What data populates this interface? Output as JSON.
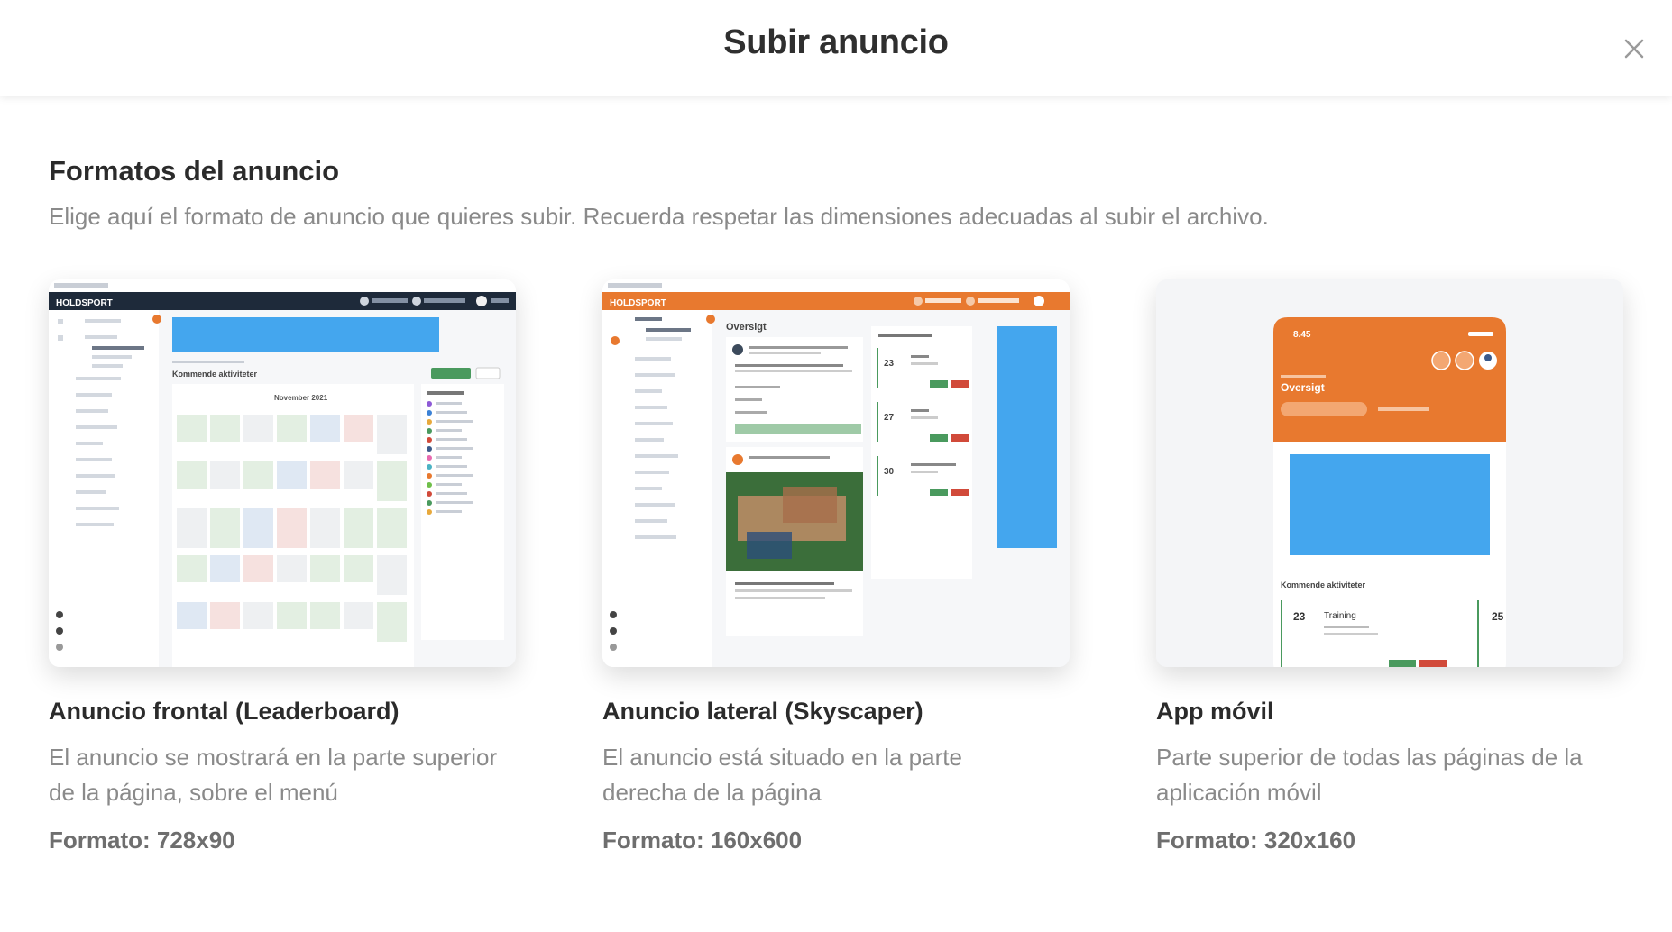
{
  "modal": {
    "title": "Subir anuncio"
  },
  "section": {
    "title": "Formatos del anuncio",
    "description": "Elige aquí el formato de anuncio que quieres subir. Recuerda respetar las dimensiones adecuadas al subir el archivo."
  },
  "formats": [
    {
      "title": "Anuncio frontal (Leaderboard)",
      "description": "El anuncio se mostrará en la parte superior de la página, sobre el menú",
      "format": "Formato: 728x90",
      "preview": {
        "logo": "HOLDSPORT",
        "heading": "Kommende aktiviteter",
        "month": "November 2021",
        "accent_color": "#1e2a3a"
      }
    },
    {
      "title": "Anuncio lateral (Skyscaper)",
      "description": "El anuncio está situado en la parte derecha de la página",
      "format": "Formato: 160x600",
      "preview": {
        "logo": "HOLDSPORT",
        "heading": "Oversigt",
        "day_1": "23",
        "day_2": "27",
        "day_3": "30",
        "accent_color": "#e8792f"
      }
    },
    {
      "title": "App móvil",
      "description": "Parte superior de todas las páginas de la aplicación móvil",
      "format": "Formato: 320x160",
      "preview": {
        "time": "8.45",
        "heading": "Oversigt",
        "section": "Kommende aktiviteter",
        "day_1": "23",
        "event": "Training",
        "day_2": "25",
        "accent_color": "#e8792f"
      }
    }
  ],
  "colors": {
    "ad_placeholder": "#44a6ee",
    "orange": "#e8792f",
    "navy": "#1e2a3a"
  }
}
